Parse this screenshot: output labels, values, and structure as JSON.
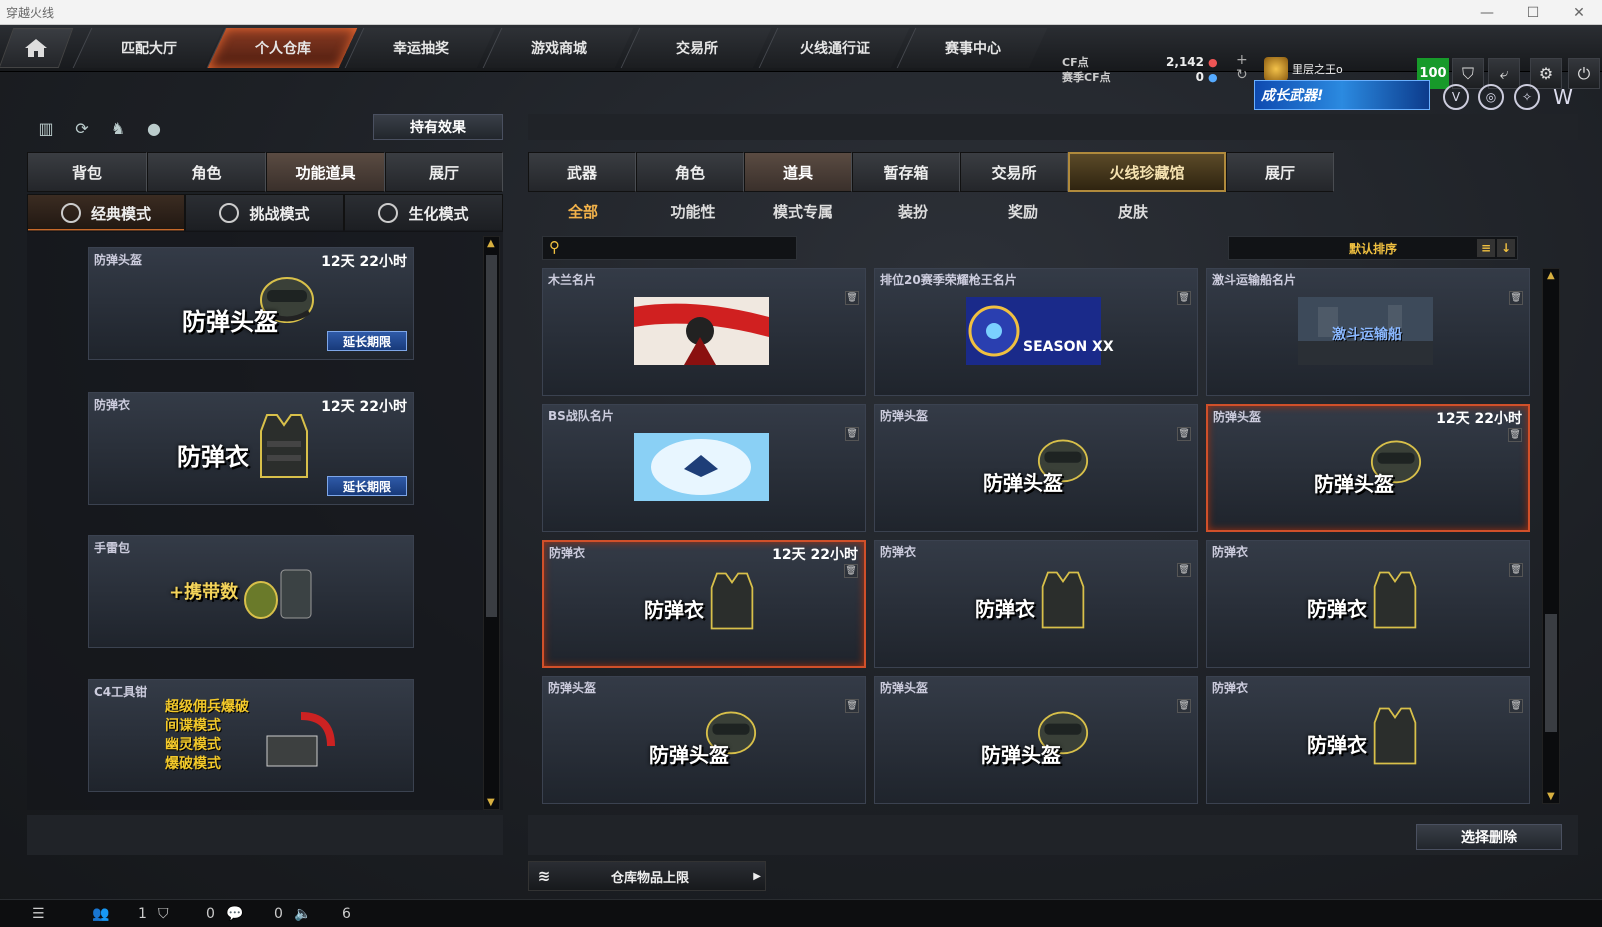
{
  "window": {
    "title": "穿越火线"
  },
  "topnav": {
    "tabs": [
      {
        "label": "匹配大厅"
      },
      {
        "label": "个人仓库"
      },
      {
        "label": "幸运抽奖"
      },
      {
        "label": "游戏商城"
      },
      {
        "label": "交易所"
      },
      {
        "label": "火线通行证"
      },
      {
        "label": "赛事中心"
      }
    ],
    "active_tab": "个人仓库",
    "cf_label": "CF点",
    "cf_value": "2,142",
    "season_cf_label": "赛季CF点",
    "season_cf_value": "0",
    "rank_name": "里层之王o",
    "level": "100"
  },
  "banner": {
    "text": "成长武器!"
  },
  "left": {
    "effect_button": "持有效果",
    "tabs": [
      {
        "label": "背包"
      },
      {
        "label": "角色"
      },
      {
        "label": "功能道具"
      },
      {
        "label": "展厅"
      }
    ],
    "active_tab": "功能道具",
    "modes": [
      {
        "label": "经典模式"
      },
      {
        "label": "挑战模式"
      },
      {
        "label": "生化模式"
      }
    ],
    "active_mode": "经典模式",
    "items": [
      {
        "name": "防弹头盔",
        "time": "12天 22小时",
        "art_text": "防弹头盔",
        "extend": "延长期限"
      },
      {
        "name": "防弹衣",
        "time": "12天 22小时",
        "art_text": "防弹衣",
        "extend": "延长期限"
      },
      {
        "name": "手雷包",
        "time": "",
        "art_text": "+携带数",
        "extend": ""
      },
      {
        "name": "C4工具钳",
        "time": "",
        "art_lines": [
          "超级佣兵爆破",
          "间谍模式",
          "幽灵模式",
          "爆破模式"
        ],
        "extend": ""
      }
    ]
  },
  "right": {
    "tabs": [
      {
        "label": "武器"
      },
      {
        "label": "角色"
      },
      {
        "label": "道具"
      },
      {
        "label": "暂存箱"
      },
      {
        "label": "交易所"
      },
      {
        "label": "火线珍藏馆"
      },
      {
        "label": "展厅"
      }
    ],
    "active_tab": "道具",
    "gold_tab": "火线珍藏馆",
    "filters": [
      {
        "label": "全部"
      },
      {
        "label": "功能性"
      },
      {
        "label": "模式专属"
      },
      {
        "label": "装扮"
      },
      {
        "label": "奖励"
      },
      {
        "label": "皮肤"
      }
    ],
    "active_filter": "全部",
    "search_placeholder": "",
    "sort_label": "默认排序",
    "items": [
      {
        "name": "木兰名片",
        "time": "",
        "type": "card-mulan",
        "art_text": ""
      },
      {
        "name": "排位20赛季荣耀枪王名片",
        "time": "",
        "type": "card-season",
        "art_text": "SEASON XX"
      },
      {
        "name": "激斗运输船名片",
        "time": "",
        "type": "card-ship",
        "art_text": "激斗运输船"
      },
      {
        "name": "BS战队名片",
        "time": "",
        "type": "card-bs",
        "art_text": ""
      },
      {
        "name": "防弹头盔",
        "time": "",
        "type": "helmet",
        "art_text": "防弹头盔"
      },
      {
        "name": "防弹头盔",
        "time": "12天 22小时",
        "type": "helmet",
        "art_text": "防弹头盔",
        "selected": true
      },
      {
        "name": "防弹衣",
        "time": "12天 22小时",
        "type": "vest",
        "art_text": "防弹衣",
        "selected": true
      },
      {
        "name": "防弹衣",
        "time": "",
        "type": "vest",
        "art_text": "防弹衣"
      },
      {
        "name": "防弹衣",
        "time": "",
        "type": "vest",
        "art_text": "防弹衣"
      },
      {
        "name": "防弹头盔",
        "time": "",
        "type": "helmet",
        "art_text": "防弹头盔"
      },
      {
        "name": "防弹头盔",
        "time": "",
        "type": "helmet",
        "art_text": "防弹头盔"
      },
      {
        "name": "防弹衣",
        "time": "",
        "type": "vest",
        "art_text": "防弹衣"
      }
    ],
    "delete_button": "选择删除",
    "storage_label": "仓库物品上限"
  },
  "statusbar": {
    "friends": "1",
    "clan": "0",
    "chat": "0",
    "volume": "6"
  },
  "colors": {
    "accent_orange": "#d0502a",
    "gold": "#f0c040",
    "level_green": "#179a2a"
  }
}
